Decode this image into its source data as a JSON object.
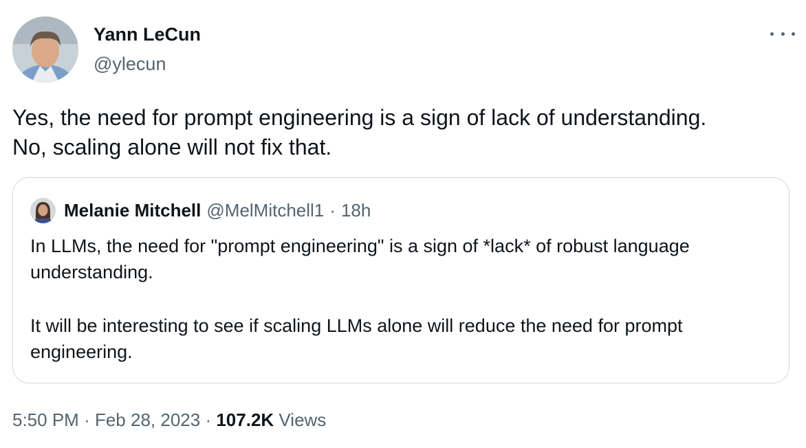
{
  "author": {
    "display_name": "Yann LeCun",
    "handle": "@ylecun"
  },
  "tweet_text": "Yes, the need for prompt engineering is a sign of lack of understanding.\nNo, scaling alone will not fix that.",
  "quoted": {
    "display_name": "Melanie Mitchell",
    "handle": "@MelMitchell1",
    "separator": "·",
    "time": "18h",
    "paragraph_1": "In LLMs, the need for \"prompt engineering\" is a sign of *lack* of robust language understanding.",
    "paragraph_2": "It will be interesting to see if scaling LLMs alone will reduce the need for prompt engineering."
  },
  "meta": {
    "time": "5:50 PM",
    "separator_1": "·",
    "date": "Feb 28, 2023",
    "separator_2": "·",
    "views_count": "107.2K",
    "views_label": "Views"
  },
  "icons": {
    "more": "more-horizontal-icon"
  },
  "colors": {
    "text_primary": "#0f1419",
    "text_secondary": "#536471",
    "border": "#cfd9de"
  }
}
